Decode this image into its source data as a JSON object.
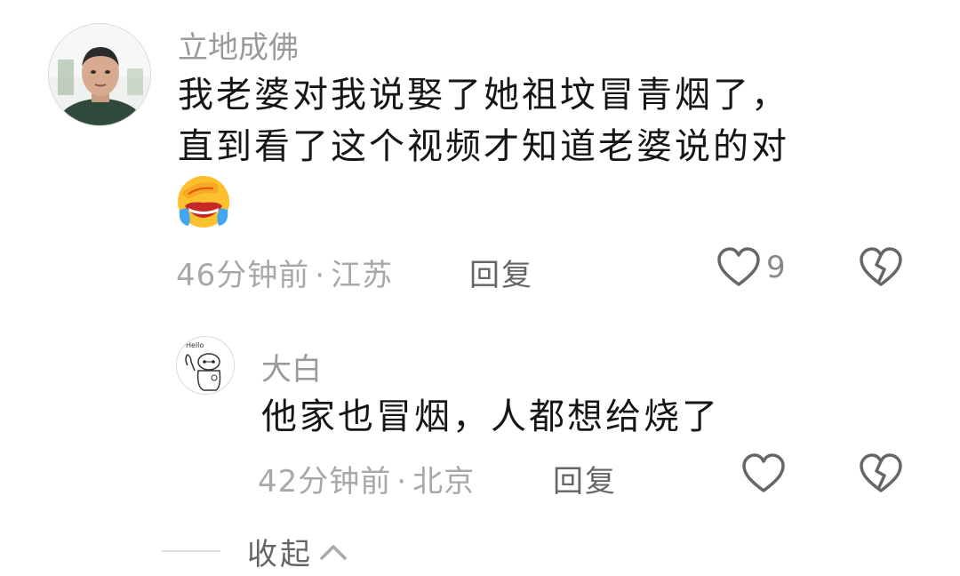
{
  "comments": [
    {
      "username": "立地成佛",
      "content_line1": "我老婆对我说娶了她祖坟冒青烟了，",
      "content_line2": "直到看了这个视频才知道老婆说的对",
      "emoji_icon": "facepalm-crying-laugh-emoji",
      "time": "46分钟前",
      "location": "江苏",
      "reply_label": "回复",
      "like_count": "9"
    },
    {
      "username": "大白",
      "content": "他家也冒烟，人都想给烧了",
      "avatar_icon": "baymax-avatar",
      "time": "42分钟前",
      "location": "北京",
      "reply_label": "回复"
    }
  ],
  "collapse": {
    "label": "收起"
  },
  "colors": {
    "meta_text": "#a8a8a8",
    "username_text": "#9a9a9a",
    "icon_stroke": "#666666"
  }
}
